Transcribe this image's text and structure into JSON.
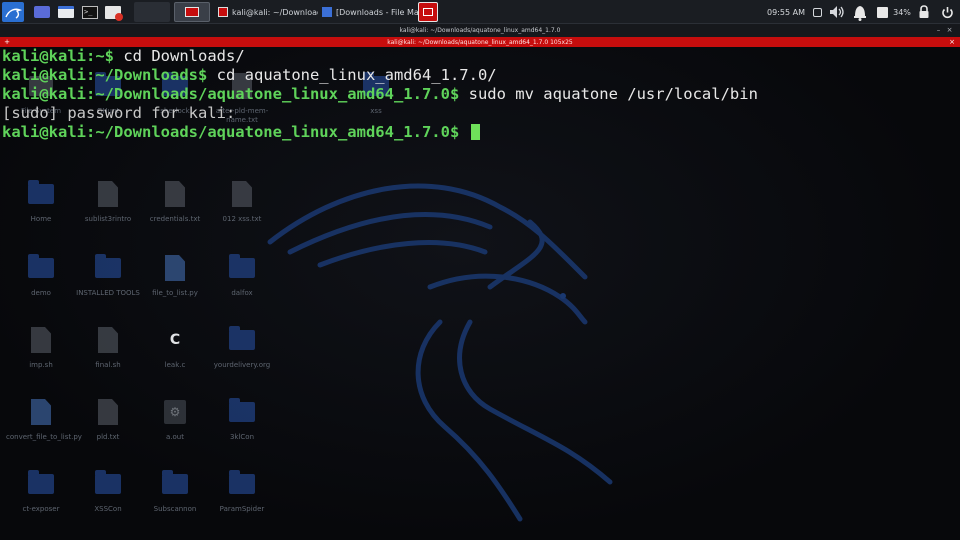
{
  "panel": {
    "taskbar": [
      {
        "label": "kali@kali: ~/Downloads/...",
        "icon": "terminal-icon"
      },
      {
        "label": "[Downloads - File Mana...",
        "icon": "folder-icon"
      }
    ],
    "clock": "09:55 AM",
    "battery": "34%"
  },
  "window": {
    "title": "kali@kali: ~/Downloads/aquatone_linux_amd64_1.7.0",
    "tab_title": "kali@kali: ~/Downloads/aquatone_linux_amd64_1.7.0 105x25"
  },
  "terminal": {
    "lines": [
      {
        "user": "kali@kali",
        "path": ":~$",
        "cmd": " cd Downloads/"
      },
      {
        "user": "kali@kali",
        "path": ":~/Downloads$",
        "cmd": " cd aquatone_linux_amd64_1.7.0/"
      },
      {
        "user": "kali@kali",
        "path": ":~/Downloads/aquatone_linux_amd64_1.7.0$",
        "cmd": " sudo mv aquatone /usr/local/bin"
      },
      {
        "text": "[sudo] password for kali:"
      },
      {
        "user": "kali@kali",
        "path": ":~/Downloads/aquatone_linux_amd64_1.7.0$",
        "cmd": " "
      }
    ]
  },
  "desktop": {
    "icons": [
      {
        "label": "File System",
        "type": "folder"
      },
      {
        "label": "GHunt",
        "type": "folder"
      },
      {
        "label": "sherlock",
        "type": "folder"
      },
      {
        "label": "after-pld-mem-name.txt",
        "type": "doc"
      },
      {
        "label": "xss",
        "type": "folder"
      },
      {
        "label": "Home",
        "type": "folder"
      },
      {
        "label": "sublist3rintro",
        "type": "doc"
      },
      {
        "label": "credentials.txt",
        "type": "doc"
      },
      {
        "label": "012 xss.txt",
        "type": "doc"
      },
      {
        "label": "demo",
        "type": "folder"
      },
      {
        "label": "INSTALLED TOOLS",
        "type": "folder"
      },
      {
        "label": "file_to_list.py",
        "type": "py"
      },
      {
        "label": "dalfox",
        "type": "folder"
      },
      {
        "label": "imp.sh",
        "type": "script"
      },
      {
        "label": "final.sh",
        "type": "script"
      },
      {
        "label": "leak.c",
        "type": "c"
      },
      {
        "label": "yourdelivery.org",
        "type": "folder"
      },
      {
        "label": "convert_file_to_list.py",
        "type": "py"
      },
      {
        "label": "pld.txt",
        "type": "doc"
      },
      {
        "label": "a.out",
        "type": "exec"
      },
      {
        "label": "3klCon",
        "type": "folder"
      },
      {
        "label": "ct-exposer",
        "type": "folder"
      },
      {
        "label": "XSSCon",
        "type": "folder"
      },
      {
        "label": "Subscannon",
        "type": "folder"
      },
      {
        "label": "ParamSpider",
        "type": "folder"
      }
    ]
  },
  "colors": {
    "prompt_green": "#5fd35a",
    "tab_red": "#c60d0d",
    "folder_blue": "#1e3a74"
  }
}
